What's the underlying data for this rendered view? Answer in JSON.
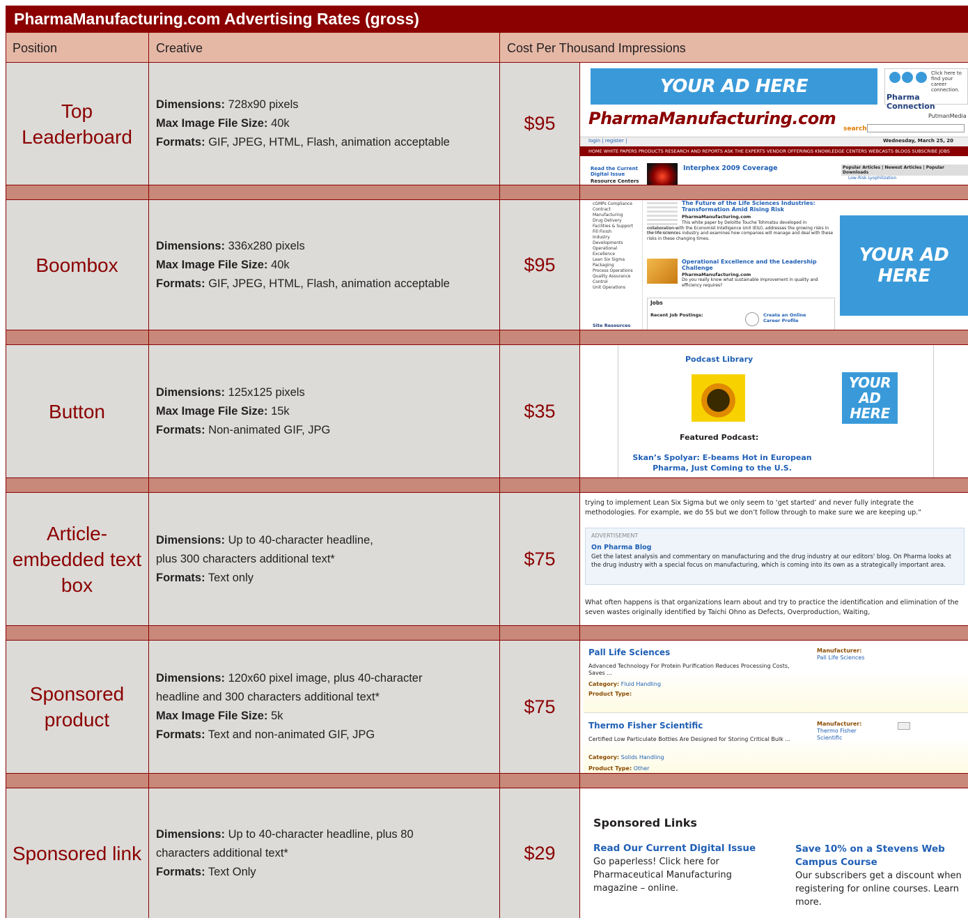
{
  "title": "PharmaManufacturing.com Advertising Rates (gross)",
  "headers": {
    "position": "Position",
    "creative": "Creative",
    "cost": "Cost Per Thousand Impressions"
  },
  "labels": {
    "dimensions": "Dimensions:",
    "max_size": "Max Image File Size:",
    "formats": "Formats:"
  },
  "rows": [
    {
      "position": "Top Leaderboard",
      "dimensions": "728x90 pixels",
      "max_size": "40k",
      "formats": "GIF, JPEG, HTML, Flash, animation acceptable",
      "cost": "$95"
    },
    {
      "position": "Boombox",
      "dimensions": "336x280 pixels",
      "max_size": "40k",
      "formats": "GIF, JPEG, HTML, Flash, animation acceptable",
      "cost": "$95"
    },
    {
      "position": "Button",
      "dimensions": "125x125 pixels",
      "max_size": "15k",
      "formats": "Non-animated GIF, JPG",
      "cost": "$35"
    },
    {
      "position": "Article-embedded text box",
      "dimensions_1": "Up to 40-character headline,",
      "dimensions_2": "plus 300 characters additional text*",
      "formats": "Text only",
      "cost": "$75"
    },
    {
      "position": "Sponsored product",
      "dimensions_1": "120x60 pixel image, plus 40-character",
      "dimensions_2": "headline and 300 characters additional text*",
      "max_size": "5k",
      "formats": "Text and non-animated GIF, JPG",
      "cost": "$75"
    },
    {
      "position": "Sponsored link",
      "dimensions_1": "Up to 40-character headline, plus 80",
      "dimensions_2": "characters additional text*",
      "formats": "Text Only",
      "cost": "$29"
    }
  ],
  "shots": {
    "leaderboard": {
      "ad": "YOUR AD HERE",
      "career_text": "Click here to find your career connection.",
      "career_brand": "Pharma Connection",
      "logo": "PharmaManufacturing.com",
      "putman": "PutmanMedia",
      "search": "search",
      "login": "login | register |",
      "date": "Wednesday, March 25, 20",
      "nav": "HOME   WHITE PAPERS   PRODUCTS   RESEARCH AND REPORTS   ASK THE EXPERTS   VENDOR OFFERINGS   KNOWLEDGE CENTERS   WEBCASTS   BLOGS   SUBSCRIBE   JOBS",
      "side1": "Read the Current Digital Issue",
      "side2": "Resource Centers",
      "headline": "Interphex 2009 Coverage",
      "tabs": "Popular Articles | Newest Articles | Popular Downloads",
      "item1": "Low-Risk Lyophilization"
    },
    "boombox": {
      "ad": "YOUR AD HERE",
      "sidebar": [
        "cGMPs Compliance",
        "Contract Manufacturing",
        "Drug Delivery",
        "Facilities & Support",
        "Fill Finish",
        "Industry Developments",
        "Operational Excellence",
        "Lean Six Sigma",
        "Packaging",
        "Process Operations",
        "Quality Assurance Control",
        "Unit Operations"
      ],
      "art1_title": "The Future of the Life Sciences Industries: Transformation Amid Rising Risk",
      "art1_src": "PharmaManufacturing.com",
      "art1_text": "This white paper by Deloitte Touche Tohmatsu developed in collaboration with the Economist Intelligence Unit (EIU), addresses the growing risks in the life sciences industry and examines how companies will manage and deal with these risks in these changing times.",
      "art2_title": "Operational Excellence and the Leadership Challenge",
      "art2_src": "PharmaManufacturing.com",
      "art2_text": "Do you really know what sustainable improvement in quality and efficiency requires?",
      "jobs": "Jobs",
      "recent": "Recent Job Postings:",
      "create": "Create an Online Career Profile",
      "site": "Site Resources"
    },
    "button": {
      "library": "Podcast Library",
      "featured": "Featured Podcast:",
      "podcast": "Skan’s Spolyar: E-beams Hot in European Pharma, Just Coming to the U.S.",
      "ad_1": "YOUR",
      "ad_2": "AD",
      "ad_3": "HERE"
    },
    "textbox": {
      "para1": "trying to implement Lean Six Sigma but we only seem to ‘get started’ and never fully integrate the methodologies.  For example, we do 5S but we don’t follow through to make sure we are keeping up.”",
      "adv": "ADVERTISEMENT",
      "headline": "On Pharma Blog",
      "body": "Get the latest analysis and commentary on manufacturing and the drug industry at our editors' blog. On Pharma looks at the drug industry with a special focus on manufacturing, which is coming into its own as a strategically important area.",
      "para2": "What often happens is that organizations learn about and try to practice the identification and elimination of the seven wastes originally identified by Taichi Ohno as Defects, Overproduction, Waiting,"
    },
    "products": [
      {
        "name": "Pall Life Sciences",
        "desc": "Advanced Technology For Protein Purification Reduces Processing Costs, Saves ...",
        "category_label": "Category:",
        "category": "Fluid Handling",
        "type_label": "Product Type:",
        "type": "",
        "mfr_label": "Manufacturer:",
        "mfr": "Pall Life Sciences"
      },
      {
        "name": "Thermo Fisher Scientific",
        "desc": "Certified Low Particulate Bottles Are Designed for Storing Critical Bulk ...",
        "category_label": "Category:",
        "category": "Solids Handling",
        "type_label": "Product Type:",
        "type": "Other",
        "mfr_label": "Manufacturer:",
        "mfr": "Thermo Fisher Scientific"
      }
    ],
    "links": {
      "heading": "Sponsored Links",
      "l1_title": "Read Our Current Digital Issue",
      "l1_text": "Go paperless! Click here for Pharmaceutical Manufacturing magazine – online.",
      "l2_title": "Save 10% on a Stevens Web Campus Course",
      "l2_text": "Our subscribers get a discount when registering for online courses. Learn more."
    }
  }
}
